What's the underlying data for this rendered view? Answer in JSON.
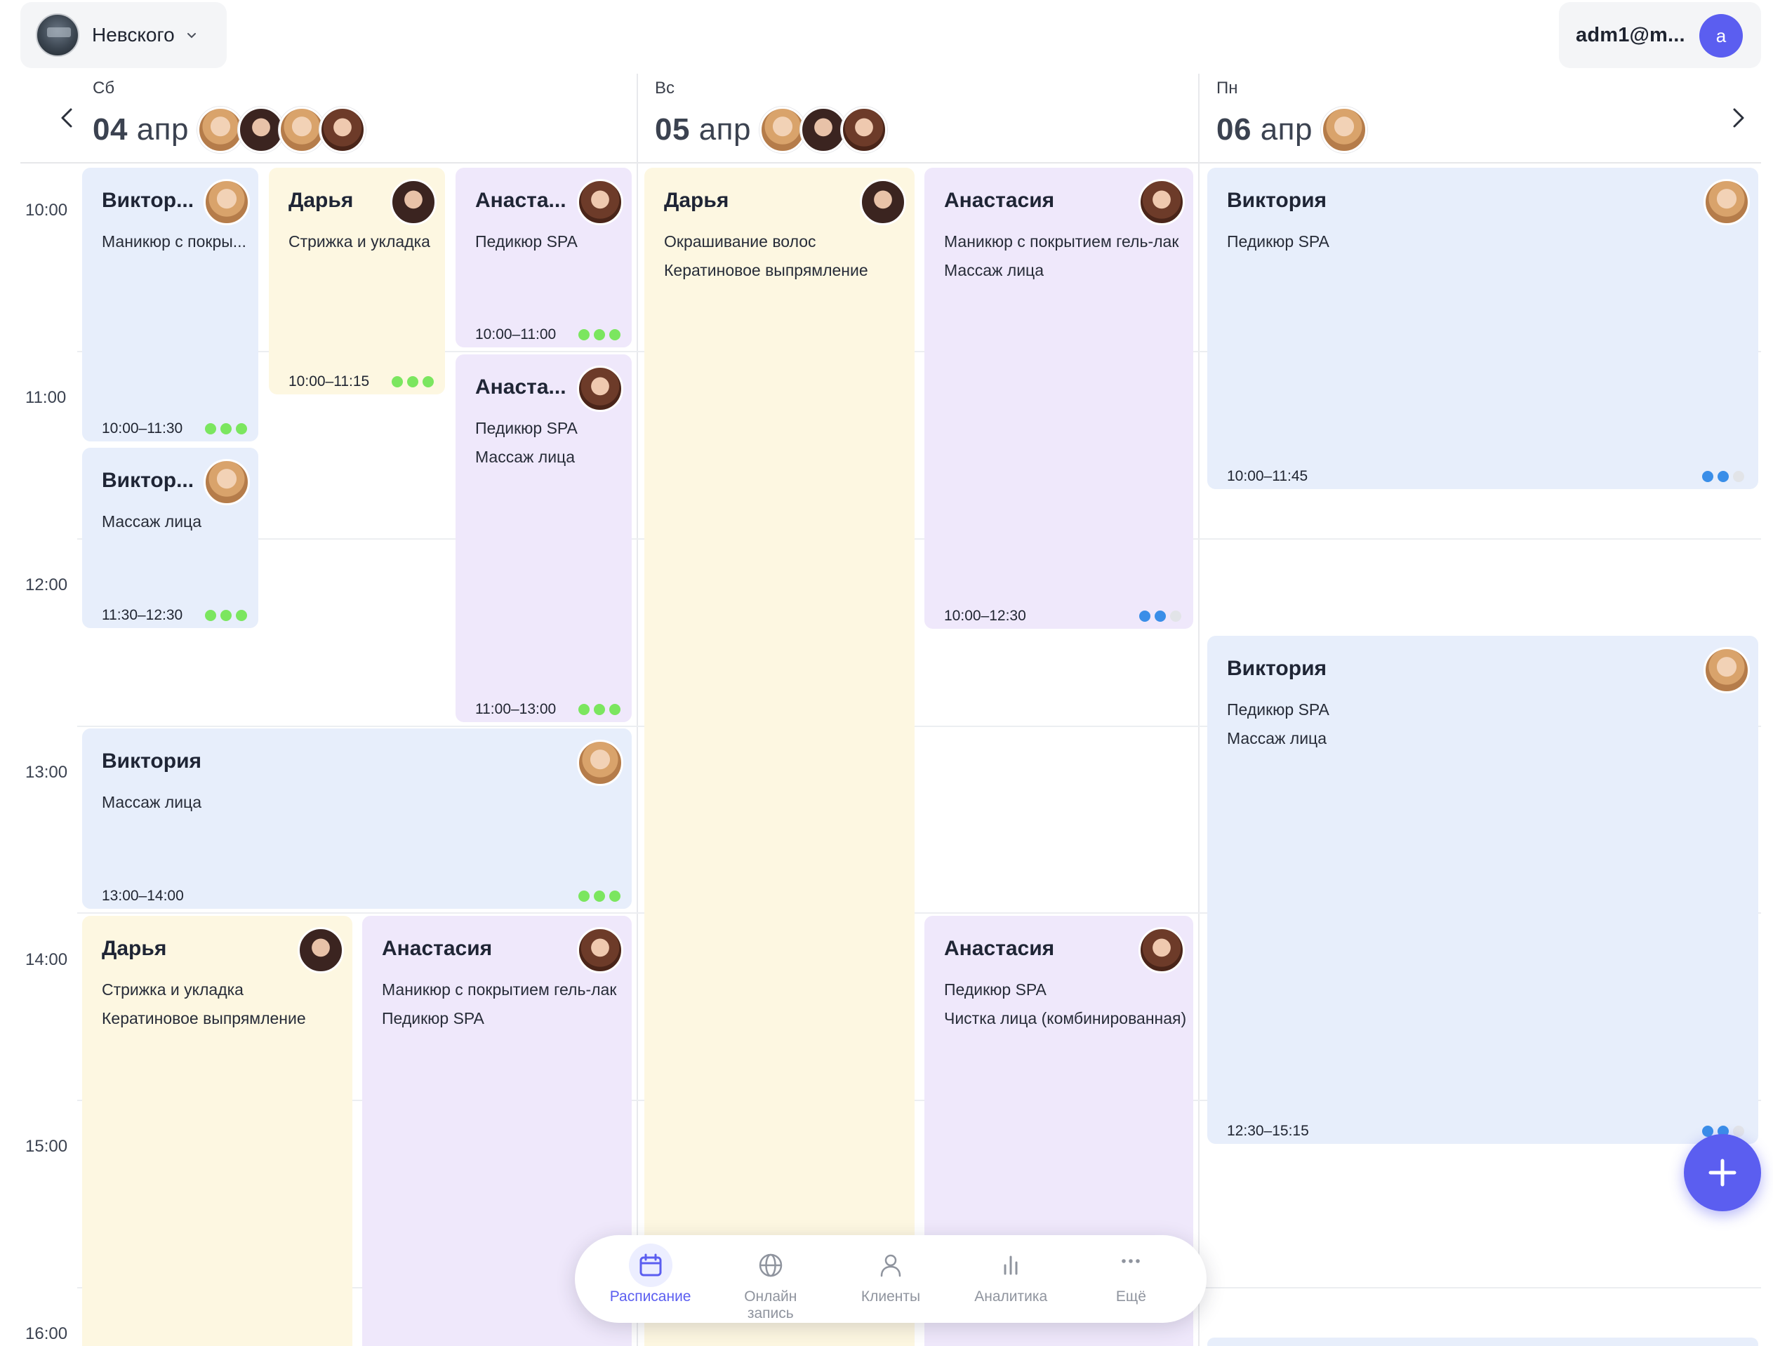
{
  "header": {
    "branch_name": "Невского",
    "user_email": "adm1@m...",
    "user_initial": "a"
  },
  "days": [
    {
      "weekday": "Сб",
      "day": "04",
      "month": "апр"
    },
    {
      "weekday": "Вс",
      "day": "05",
      "month": "апр"
    },
    {
      "weekday": "Пн",
      "day": "06",
      "month": "апр"
    }
  ],
  "time_labels": [
    "10:00",
    "11:00",
    "12:00",
    "13:00",
    "14:00",
    "15:00",
    "16:00"
  ],
  "events": [
    {
      "name": "Виктор...",
      "services": [
        "Маникюр с покры..."
      ],
      "time": "10:00–11:30",
      "status": "green",
      "color": "blue",
      "avatar": "blonde"
    },
    {
      "name": "Дарья",
      "services": [
        "Стрижка и укладка"
      ],
      "time": "10:00–11:15",
      "status": "green",
      "color": "yellow",
      "avatar": "dark"
    },
    {
      "name": "Анаста...",
      "services": [
        "Педикюр SPA"
      ],
      "time": "10:00–11:00",
      "status": "green",
      "color": "purple",
      "avatar": "brown"
    },
    {
      "name": "Анаста...",
      "services": [
        "Педикюр SPA",
        "Массаж лица"
      ],
      "time": "11:00–13:00",
      "status": "green",
      "color": "purple",
      "avatar": "brown"
    },
    {
      "name": "Виктор...",
      "services": [
        "Массаж лица"
      ],
      "time": "11:30–12:30",
      "status": "green",
      "color": "blue",
      "avatar": "blonde"
    },
    {
      "name": "Виктория",
      "services": [
        "Массаж лица"
      ],
      "time": "13:00–14:00",
      "status": "green",
      "color": "blue",
      "avatar": "blonde"
    },
    {
      "name": "Дарья",
      "services": [
        "Стрижка и укладка",
        "Кератиновое выпрямление"
      ],
      "time": "",
      "status": "",
      "color": "yellow",
      "avatar": "dark"
    },
    {
      "name": "Анастасия",
      "services": [
        "Маникюр с покрытием гель-лак",
        "Педикюр SPA"
      ],
      "time": "",
      "status": "",
      "color": "purple",
      "avatar": "brown"
    },
    {
      "name": "Дарья",
      "services": [
        "Окрашивание волос",
        "Кератиновое выпрямление"
      ],
      "time": "",
      "status": "",
      "color": "yellow",
      "avatar": "dark"
    },
    {
      "name": "Анастасия",
      "services": [
        "Маникюр с покрытием гель-лак",
        "Массаж лица"
      ],
      "time": "10:00–12:30",
      "status": "blue",
      "color": "purple",
      "avatar": "brown"
    },
    {
      "name": "Анастасия",
      "services": [
        "Педикюр SPA",
        "Чистка лица (комбинированная)"
      ],
      "time": "",
      "status": "",
      "color": "purple",
      "avatar": "brown"
    },
    {
      "name": "Виктория",
      "services": [
        "Педикюр SPA"
      ],
      "time": "10:00–11:45",
      "status": "blue",
      "color": "blue",
      "avatar": "blonde"
    },
    {
      "name": "Виктория",
      "services": [
        "Педикюр SPA",
        "Массаж лица"
      ],
      "time": "12:30–15:15",
      "status": "blue",
      "color": "blue",
      "avatar": "blonde"
    }
  ],
  "status_colors": {
    "green": "#7be65f",
    "blue": "#3a8ee8",
    "empty": "#e2e4e8"
  },
  "accent_color": "#5b5ef0",
  "bottom_nav": [
    {
      "label": "Расписание",
      "icon": "calendar-icon",
      "active": true
    },
    {
      "label": "Онлайн запись",
      "icon": "globe-icon",
      "active": false
    },
    {
      "label": "Клиенты",
      "icon": "person-icon",
      "active": false
    },
    {
      "label": "Аналитика",
      "icon": "chart-icon",
      "active": false
    },
    {
      "label": "Ещё",
      "icon": "more-icon",
      "active": false
    }
  ]
}
